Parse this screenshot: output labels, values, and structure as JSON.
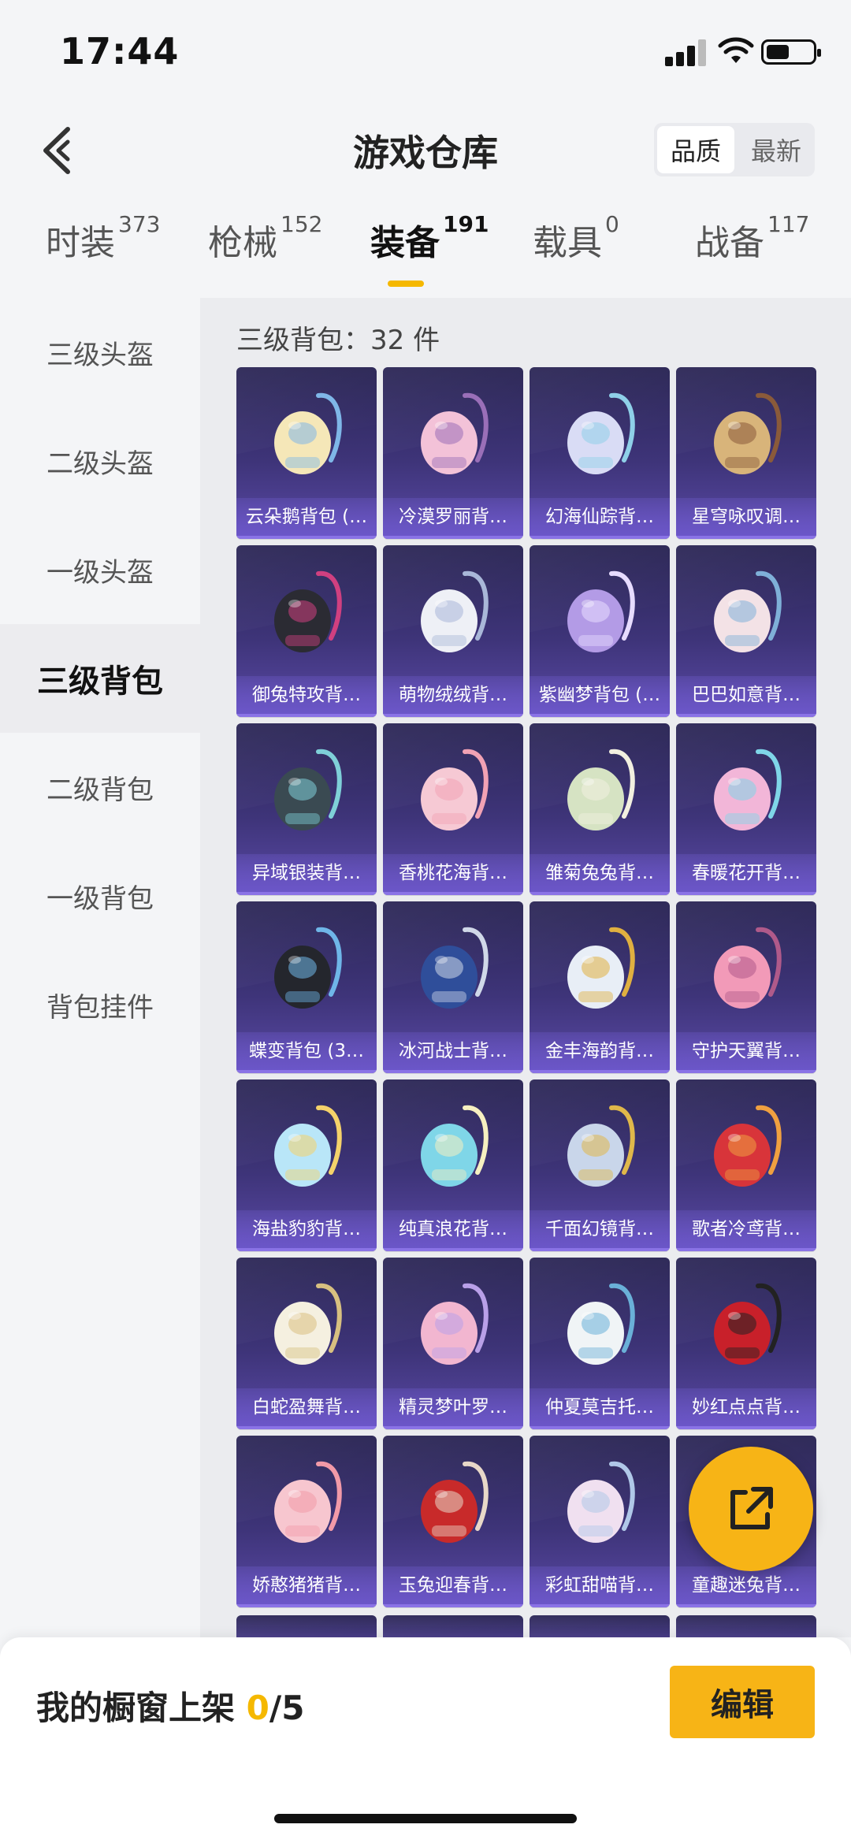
{
  "status_bar": {
    "time": "17:44"
  },
  "header": {
    "title": "游戏仓库",
    "sort_options": [
      "品质",
      "最新"
    ],
    "sort_active": "品质"
  },
  "tabs": [
    {
      "label": "时装",
      "count": "373"
    },
    {
      "label": "枪械",
      "count": "152"
    },
    {
      "label": "装备",
      "count": "191",
      "active": true
    },
    {
      "label": "载具",
      "count": "0"
    },
    {
      "label": "战备",
      "count": "117"
    }
  ],
  "sidebar": {
    "items": [
      "三级头盔",
      "二级头盔",
      "一级头盔",
      "三级背包",
      "二级背包",
      "一级背包",
      "背包挂件"
    ],
    "active": "三级背包"
  },
  "content": {
    "count_label": "三级背包：32 件",
    "items": [
      "云朵鹅背包 (…",
      "冷漠罗丽背…",
      "幻海仙踪背…",
      "星穹咏叹调…",
      "御兔特攻背…",
      "萌物绒绒背…",
      "紫幽梦背包 (…",
      "巴巴如意背…",
      "异域银装背…",
      "香桃花海背…",
      "雏菊兔兔背…",
      "春暖花开背…",
      "蝶变背包 (3…",
      "冰河战士背…",
      "金丰海韵背…",
      "守护天翼背…",
      "海盐豹豹背…",
      "纯真浪花背…",
      "千面幻镜背…",
      "歌者冷鸢背…",
      "白蛇盈舞背…",
      "精灵梦叶罗…",
      "仲夏莫吉托…",
      "妙红点点背…",
      "娇憨猪猪背…",
      "玉兔迎春背…",
      "彩虹甜喵背…",
      "童趣迷兔背…"
    ],
    "accent_colors": [
      "#f7b416",
      "#6b56c8",
      "#2b2655"
    ]
  },
  "bottom": {
    "shelf_label": "我的橱窗上架 ",
    "shelf_current": "0",
    "shelf_total": "/5",
    "edit_label": "编辑"
  }
}
